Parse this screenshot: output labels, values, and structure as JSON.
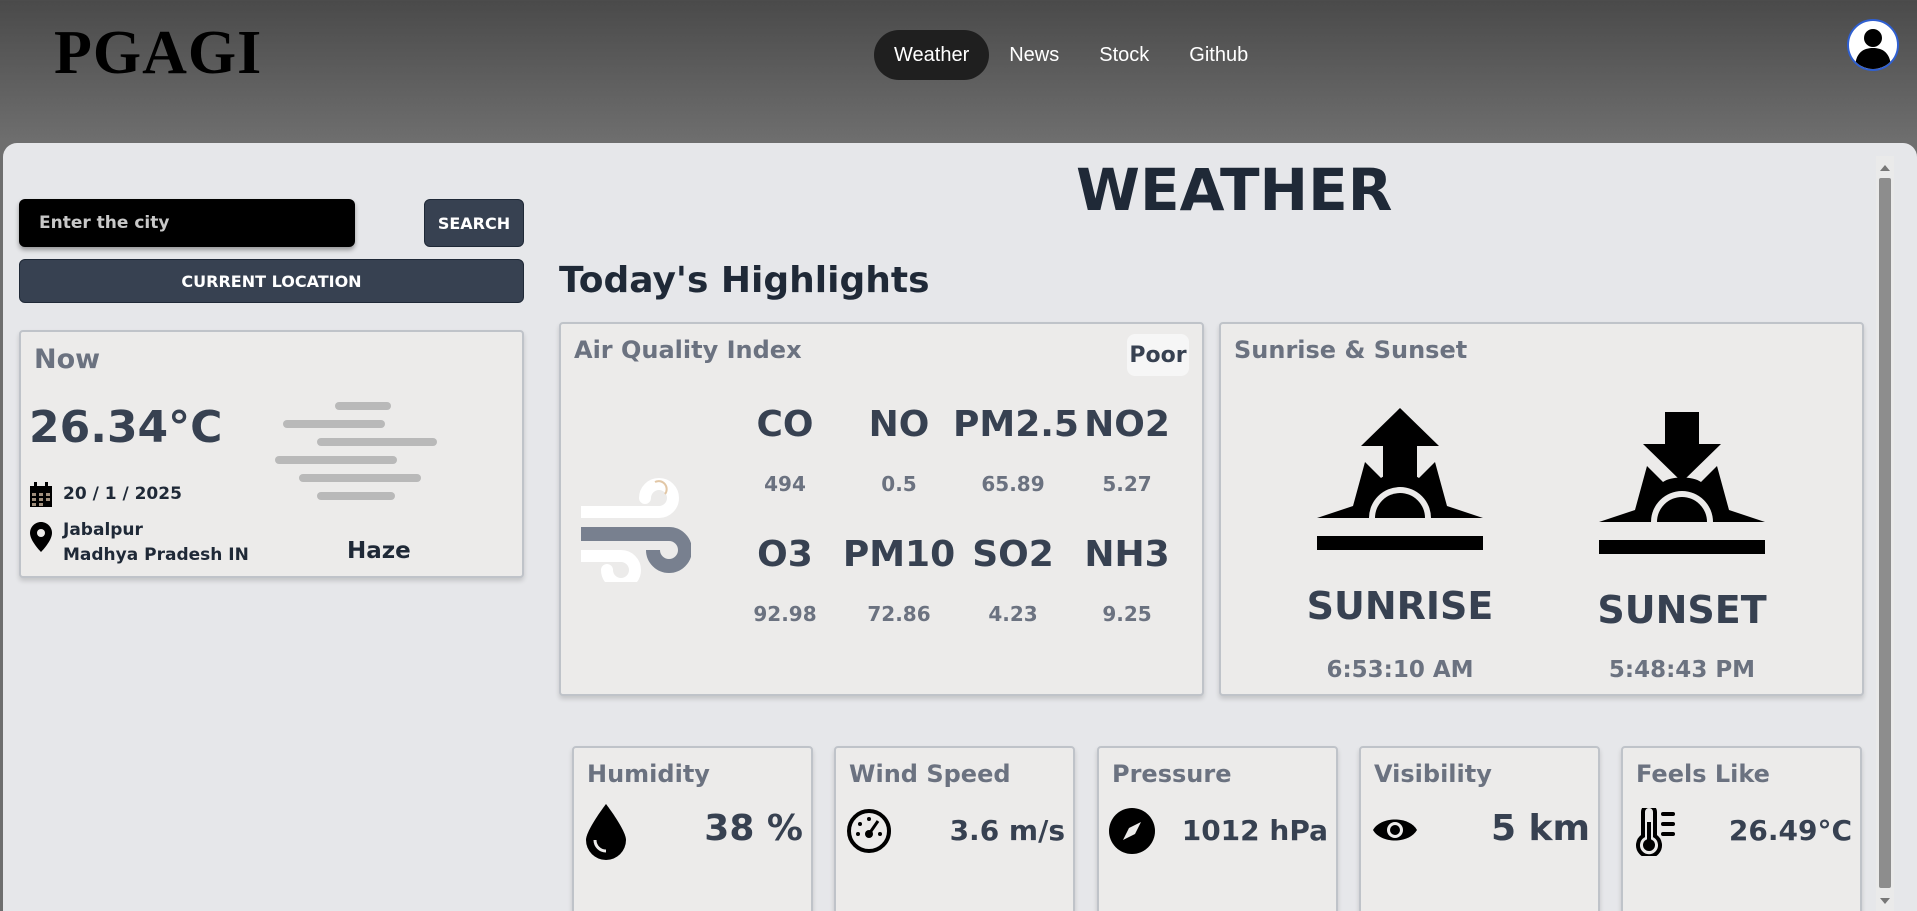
{
  "header": {
    "logo": "PGAGI",
    "nav": [
      {
        "label": "Weather",
        "active": true
      },
      {
        "label": "News",
        "active": false
      },
      {
        "label": "Stock",
        "active": false
      },
      {
        "label": "Github",
        "active": false
      }
    ],
    "avatar_icon": "user-avatar-icon",
    "accent_color": "#2f5fd0"
  },
  "search": {
    "placeholder": "Enter the city",
    "value": "",
    "search_label": "SEARCH",
    "location_label": "CURRENT LOCATION"
  },
  "now": {
    "title": "Now",
    "temperature": "26.34°C",
    "date": "20 / 1 / 2025",
    "city": "Jabalpur",
    "region": "Madhya Pradesh IN",
    "condition": "Haze",
    "condition_icon": "haze-icon"
  },
  "page": {
    "title": "WEATHER",
    "section_title": "Today's Highlights"
  },
  "aqi": {
    "title": "Air Quality Index",
    "status": "Poor",
    "icon": "wind-icon",
    "pollutants": [
      {
        "name": "CO",
        "value": "494"
      },
      {
        "name": "NO",
        "value": "0.5"
      },
      {
        "name": "PM2.5",
        "value": "65.89"
      },
      {
        "name": "NO2",
        "value": "5.27"
      },
      {
        "name": "O3",
        "value": "92.98"
      },
      {
        "name": "PM10",
        "value": "72.86"
      },
      {
        "name": "SO2",
        "value": "4.23"
      },
      {
        "name": "NH3",
        "value": "9.25"
      }
    ]
  },
  "sun": {
    "title": "Sunrise & Sunset",
    "sunrise_label": "SUNRISE",
    "sunrise_time": "6:53:10 AM",
    "sunset_label": "SUNSET",
    "sunset_time": "5:48:43 PM"
  },
  "metrics": [
    {
      "title": "Humidity",
      "value": "38 %",
      "icon": "droplet-icon"
    },
    {
      "title": "Wind Speed",
      "value": "3.6 m/s",
      "icon": "gauge-icon"
    },
    {
      "title": "Pressure",
      "value": "1012 hPa",
      "icon": "compass-icon"
    },
    {
      "title": "Visibility",
      "value": "5 km",
      "icon": "eye-icon"
    },
    {
      "title": "Feels Like",
      "value": "26.49°C",
      "icon": "thermometer-icon"
    }
  ]
}
